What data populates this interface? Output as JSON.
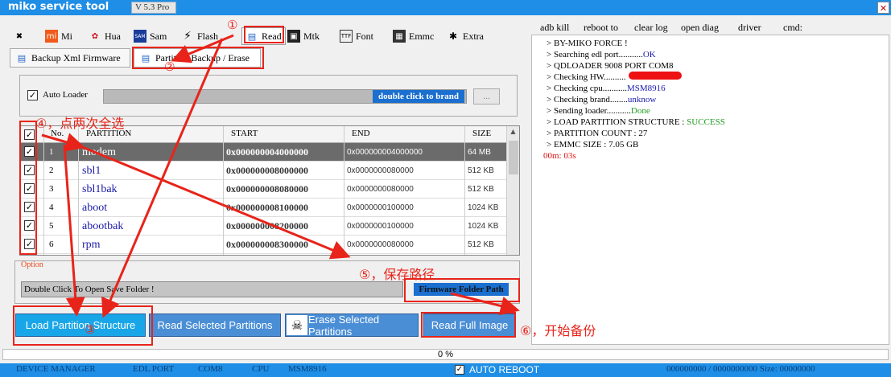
{
  "app": {
    "title": "miko service tool",
    "version": "V 5.3 Pro",
    "close": "✕"
  },
  "main_tabs": [
    {
      "label": "",
      "icon": "tools-icon"
    },
    {
      "label": "Mi",
      "icon": "mi-icon"
    },
    {
      "label": "Hua",
      "icon": "huawei-icon"
    },
    {
      "label": "Sam",
      "icon": "samsung-icon"
    },
    {
      "label": "Flash",
      "icon": "flash-icon"
    },
    {
      "label": "Read",
      "icon": "database-icon"
    },
    {
      "label": "Mtk",
      "icon": "chip-icon"
    },
    {
      "label": "Font",
      "icon": "ttf-icon"
    },
    {
      "label": "Emmc",
      "icon": "emmc-icon"
    },
    {
      "label": "Extra",
      "icon": "extra-icon"
    }
  ],
  "sub_tabs": {
    "backup_xml": "Backup Xml Firmware",
    "partition_backup": "Partition Backup / Erase"
  },
  "auto_loader": {
    "label": "Auto Loader",
    "checked": true,
    "brand_text": "double click to brand",
    "more": "..."
  },
  "grid": {
    "headers": {
      "no": "No.",
      "partition": "PARTITION",
      "start": "START",
      "end": "END",
      "size": "SIZE",
      "sort": "▲"
    },
    "rows": [
      {
        "no": "1",
        "partition": "modem",
        "start": "0x000000004000000",
        "end": "0x000000004000000",
        "size": "64 MB",
        "selected": true
      },
      {
        "no": "2",
        "partition": "sbl1",
        "start": "0x000000008000000",
        "end": "0x0000000080000",
        "size": "512 KB"
      },
      {
        "no": "3",
        "partition": "sbl1bak",
        "start": "0x000000008080000",
        "end": "0x0000000080000",
        "size": "512 KB"
      },
      {
        "no": "4",
        "partition": "aboot",
        "start": "0x000000008100000",
        "end": "0x0000000100000",
        "size": "1024 KB"
      },
      {
        "no": "5",
        "partition": "abootbak",
        "start": "0x000000008200000",
        "end": "0x0000000100000",
        "size": "1024 KB"
      },
      {
        "no": "6",
        "partition": "rpm",
        "start": "0x000000008300000",
        "end": "0x0000000080000",
        "size": "512 KB"
      }
    ],
    "check_mark": "✓",
    "scroll_up": "▲"
  },
  "option": {
    "label": "Option",
    "save_folder": "Double Click To Open Save Folder !",
    "firmware_folder": "Firmware Folder Path"
  },
  "buttons": {
    "load": "Load Partition Structure",
    "read_selected": "Read Selected Partitions",
    "erase_selected": "Erase Selected Partitions",
    "read_full": "Read Full Image",
    "skull": "☠"
  },
  "progress": "0 %",
  "status": {
    "device_manager": "DEVICE MANAGER",
    "edl_port": "EDL PORT",
    "com": "COM8",
    "cpu": "CPU",
    "cpu_value": "MSM8916",
    "auto_reboot": "AUTO REBOOT",
    "counter": "000000000 / 0000000000 Size: 00000000"
  },
  "right_toolbar": [
    "adb kill",
    "reboot to",
    "clear log",
    "open diag",
    "driver",
    "cmd:"
  ],
  "log": [
    {
      "text": "> BY-MIKO FORCE !",
      "value": ""
    },
    {
      "text": "> Searching edl port...........",
      "value": "OK",
      "cls": "ok"
    },
    {
      "text": "> QDLOADER 9008 PORT COM8",
      "value": ""
    },
    {
      "text": "> Checking HW..........",
      "value": ""
    },
    {
      "text": "> Checking cpu...........",
      "value": "MSM8916",
      "cls": "ok"
    },
    {
      "text": "> Checking brand........",
      "value": "unknow",
      "cls": "ok"
    },
    {
      "text": "> Sending loader...........",
      "value": "Done",
      "cls": "succ"
    },
    {
      "text": "> LOAD PARTITION  STRUCTURE  :  ",
      "value": "SUCCESS",
      "cls": "succ"
    },
    {
      "text": "> PARTITION COUNT  :  27",
      "value": ""
    },
    {
      "text": "> EMMC SIZE  :  7.05 GB",
      "value": ""
    },
    {
      "text": "",
      "value": "00m: 03s",
      "cls": "time"
    }
  ],
  "annotations": {
    "n1": "①",
    "n2": "②",
    "n3": "③",
    "n4": "④，点两次全选",
    "n5": "⑤，保存路径",
    "n6": "⑥，开始备份"
  },
  "colors": {
    "accent": "#1e8ee6",
    "annotation": "#e8241a",
    "selected_row": "#6b6b6b",
    "button": "#4a8ed6"
  }
}
